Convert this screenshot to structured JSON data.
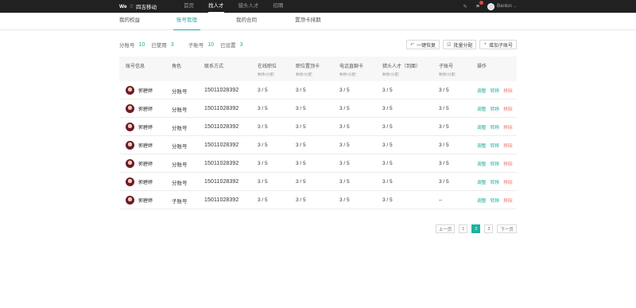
{
  "brand": {
    "we": "We",
    "company": "四吉移动"
  },
  "topnav": [
    {
      "label": "首页",
      "active": false
    },
    {
      "label": "找人才",
      "active": true
    },
    {
      "label": "猎头人才",
      "active": false
    },
    {
      "label": "招聘",
      "active": false
    }
  ],
  "user": {
    "name": "Banlon"
  },
  "subtabs": [
    {
      "label": "我的权益"
    },
    {
      "label": "账号管理"
    },
    {
      "label": "我的合同"
    },
    {
      "label": "置顶卡排期"
    }
  ],
  "stats": {
    "sub_account_label": "分账号",
    "sub_account_value": "10",
    "used_label": "已使用",
    "used_value": "3",
    "child_label": "子账号",
    "child_value": "10",
    "set_label": "已设置",
    "set_value": "3"
  },
  "actions": {
    "restore": "一键恢复",
    "batch": "批量分配",
    "add": "增加子账号"
  },
  "table": {
    "headers": {
      "info": "账号信息",
      "role": "角色",
      "contact": "联系方式",
      "online": "在线职位",
      "online_sub": "剩余/分配",
      "top": "职位置顶卡",
      "top_sub": "剩余/分配",
      "phone": "电话直聊卡",
      "phone_sub": "剩余/分配",
      "hunter": "猎头人才（到面）",
      "hunter_sub": "剩余/分配",
      "child": "子账号",
      "child_sub": "剩余/分配",
      "ops": "操作"
    },
    "rows": [
      {
        "name": "郭碧婷",
        "role": "分账号",
        "phone": "15011028392",
        "online": "3 / 5",
        "top": "3 / 5",
        "call": "3 / 5",
        "hunter": "3 / 5",
        "child": "3 / 5",
        "op1": "调整",
        "op2": "转移",
        "op3": "移除"
      },
      {
        "name": "郭碧婷",
        "role": "分账号",
        "phone": "15011028392",
        "online": "3 / 5",
        "top": "3 / 5",
        "call": "3 / 5",
        "hunter": "3 / 5",
        "child": "3 / 5",
        "op1": "调整",
        "op2": "转移",
        "op3": "移除"
      },
      {
        "name": "郭碧婷",
        "role": "分账号",
        "phone": "15011028392",
        "online": "3 / 5",
        "top": "3 / 5",
        "call": "3 / 5",
        "hunter": "3 / 5",
        "child": "3 / 5",
        "op1": "调整",
        "op2": "转移",
        "op3": "移除"
      },
      {
        "name": "郭碧婷",
        "role": "分账号",
        "phone": "15011028392",
        "online": "3 / 5",
        "top": "3 / 5",
        "call": "3 / 5",
        "hunter": "3 / 5",
        "child": "3 / 5",
        "op1": "调整",
        "op2": "转移",
        "op3": "移除"
      },
      {
        "name": "郭碧婷",
        "role": "分账号",
        "phone": "15011028392",
        "online": "3 / 5",
        "top": "3 / 5",
        "call": "3 / 5",
        "hunter": "3 / 5",
        "child": "3 / 5",
        "op1": "调整",
        "op2": "转移",
        "op3": "移除"
      },
      {
        "name": "郭碧婷",
        "role": "分账号",
        "phone": "15011028392",
        "online": "3 / 5",
        "top": "3 / 5",
        "call": "3 / 5",
        "hunter": "3 / 5",
        "child": "3 / 5",
        "op1": "调整",
        "op2": "转移",
        "op3": "移除"
      },
      {
        "name": "郭碧婷",
        "role": "子账号",
        "phone": "15011028392",
        "online": "3 / 5",
        "top": "3 / 5",
        "call": "3 / 5",
        "hunter": "3 / 5",
        "child": "--",
        "op1": "调整",
        "op2": "转移",
        "op3": "移除"
      }
    ]
  },
  "pager": {
    "prev": "上一页",
    "pages": [
      "1",
      "2",
      "3"
    ],
    "current": "2",
    "next": "下一页"
  },
  "colors": {
    "accent": "#1fb19e",
    "danger": "#e8776b",
    "topbar": "#212121"
  }
}
